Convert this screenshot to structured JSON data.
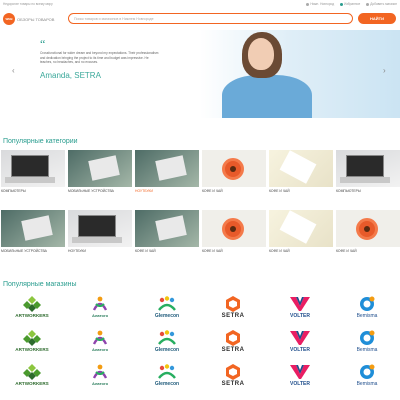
{
  "topbar": {
    "tagline": "Недорогие товары по всему миру",
    "city": "Нижн. Новгород",
    "favorites": "Избранное",
    "account": "Добавить магазин"
  },
  "header": {
    "logo_text": "WEB",
    "logo_sub": "ОБЗОРЫ ТОВАРОВ",
    "search_placeholder": "Поиск товаров и магазинов в Нижнем Новгороде",
    "search_button": "НАЙТИ"
  },
  "hero": {
    "quote_mark": "“",
    "text": "Crossfunctional for wider dream and beyond my expectations. Their professionalism and dedication bringing the project to its time and budget was impressive. He teaches, no headaches, and no excuses.",
    "name": "Amanda, SETRA",
    "prev": "‹",
    "next": "›"
  },
  "categories": {
    "title": "Популярные категории",
    "items": [
      {
        "label": "КОМПЬЮТЕРЫ",
        "img": "laptop",
        "highlight": false
      },
      {
        "label": "МОБИЛЬНЫЕ УСТРОЙСТВА",
        "img": "hands",
        "highlight": false
      },
      {
        "label": "НОУТБУКИ",
        "img": "hands",
        "highlight": true
      },
      {
        "label": "КОФЕ И ЧАЙ",
        "img": "coffee",
        "highlight": false
      },
      {
        "label": "КОФЕ И ЧАЙ",
        "img": "desk",
        "highlight": false
      },
      {
        "label": "КОМПЬЮТЕРЫ",
        "img": "laptop",
        "highlight": false
      },
      {
        "label": "МОБИЛЬНЫЕ УСТРОЙСТВА",
        "img": "hands",
        "highlight": false
      },
      {
        "label": "НОУТБУКИ",
        "img": "laptop",
        "highlight": false
      },
      {
        "label": "КОФЕ И ЧАЙ",
        "img": "hands",
        "highlight": false
      },
      {
        "label": "КОФЕ И ЧАЙ",
        "img": "coffee",
        "highlight": false
      },
      {
        "label": "КОФЕ И ЧАЙ",
        "img": "desk",
        "highlight": false
      },
      {
        "label": "КОФЕ И ЧАЙ",
        "img": "coffee",
        "highlight": false
      }
    ]
  },
  "stores": {
    "title": "Популярные магазины",
    "brands": [
      {
        "name": "ARTWORKERS",
        "key": "art"
      },
      {
        "name": "Алатого",
        "key": "ala"
      },
      {
        "name": "Glemecon",
        "key": "gle"
      },
      {
        "name": "SETRA",
        "key": "set"
      },
      {
        "name": "VOLTER",
        "key": "vol"
      },
      {
        "name": "Bemisma",
        "key": "bem"
      }
    ]
  },
  "colors": {
    "accent": "#f26522",
    "teal": "#2a9d8f"
  }
}
